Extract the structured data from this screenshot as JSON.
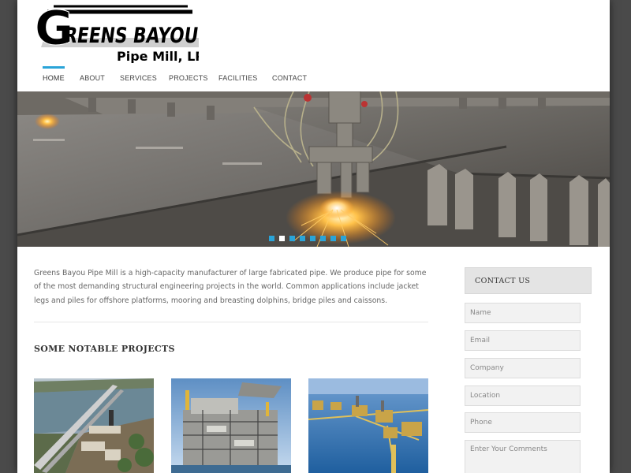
{
  "brand": {
    "name_line1": "REENS BAYOU",
    "name_line2": "Pipe Mill, LP",
    "logo_letter": "G"
  },
  "nav": {
    "items": [
      {
        "label": "HOME"
      },
      {
        "label": "ABOUT"
      },
      {
        "label": "SERVICES"
      },
      {
        "label": "PROJECTS"
      },
      {
        "label": "FACILITIES"
      },
      {
        "label": "CONTACT"
      }
    ],
    "active": "HOME"
  },
  "slider": {
    "dot_count": 8,
    "active_index": 1
  },
  "intro": {
    "text": "Greens Bayou Pipe Mill is a high-capacity manufacturer of large fabricated pipe. We produce pipe for some of the most demanding structural engineering projects in the world. Common applications include jacket legs and piles for offshore platforms, mooring and breasting dolphins, bridge piles and caissons."
  },
  "projects": {
    "title": "SOME NOTABLE PROJECTS"
  },
  "contact": {
    "title": "CONTACT US",
    "fields": {
      "name": "Name",
      "email": "Email",
      "company": "Company",
      "location": "Location",
      "phone": "Phone",
      "comments": "Enter Your Comments"
    }
  },
  "colors": {
    "accent": "#2aa4d8",
    "page_bg": "#4a4a4a",
    "content_bg": "#ffffff"
  }
}
